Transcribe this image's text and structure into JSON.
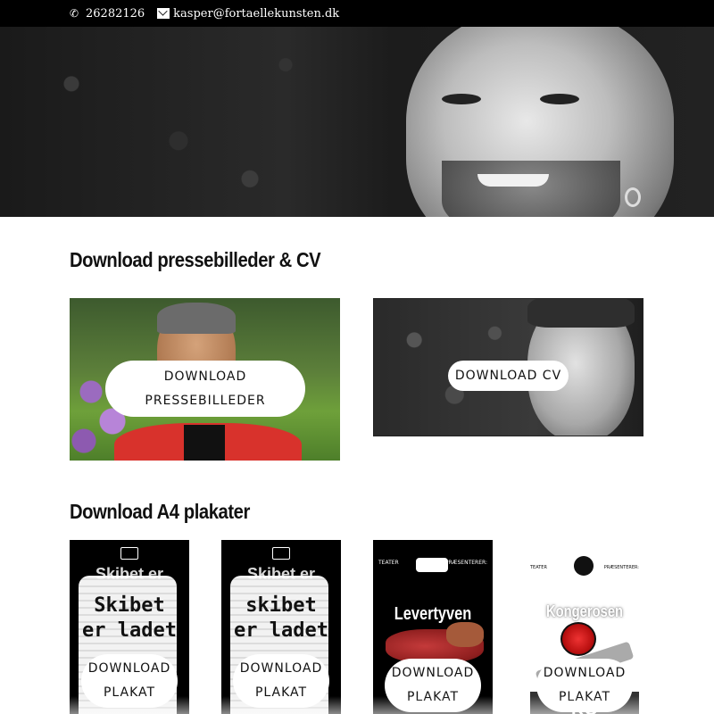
{
  "topbar": {
    "phone_icon": "phone-icon",
    "phone": "26282126",
    "email_icon": "envelope-icon",
    "email": "kasper@fortaellekunsten.dk"
  },
  "sections": {
    "press_title": "Download pressebilleder & CV",
    "posters_title": "Download A4 plakater"
  },
  "press_cards": {
    "press_button_line1": "DOWNLOAD",
    "press_button_line2": "PRESSEBILLEDER",
    "cv_button": "DOWNLOAD CV"
  },
  "posters": [
    {
      "ghost_title": "Skibet er",
      "big_title_line1": "Skibet",
      "big_title_line2": "er ladet",
      "button_line1": "DOWNLOAD",
      "button_line2": "PLAKAT"
    },
    {
      "ghost_title": "Skibet er",
      "big_title_line1": "skibet",
      "big_title_line2": "er ladet",
      "button_line1": "DOWNLOAD",
      "button_line2": "PLAKAT"
    },
    {
      "header_left": "TEATER",
      "header_right": "PRÆSENTERER:",
      "title": "Levertyven",
      "button_line1": "DOWNLOAD",
      "button_line2": "PLAKAT"
    },
    {
      "header_left": "TEATER",
      "header_right": "PRÆSENTERER:",
      "title": "Kongerosen",
      "base_text": "KO",
      "button_line1": "DOWNLOAD",
      "button_line2": "PLAKAT"
    }
  ],
  "colors": {
    "topbar_bg": "#000000",
    "button_bg": "#ffffff",
    "jacket_red": "#d8322c"
  }
}
